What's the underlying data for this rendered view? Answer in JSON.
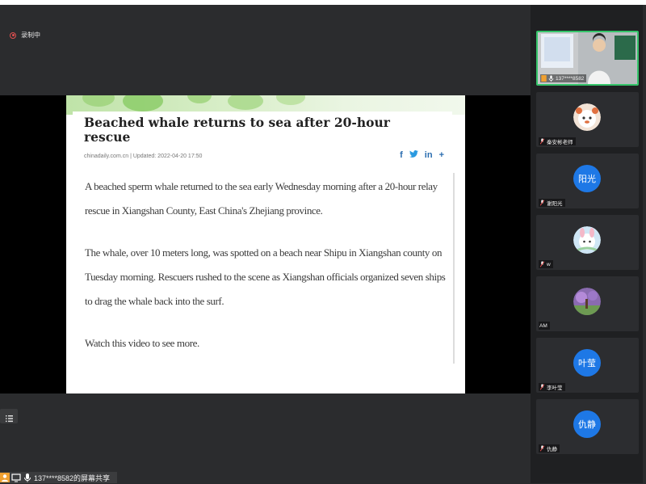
{
  "recording": {
    "label": "录制中"
  },
  "article": {
    "headline": "Beached whale returns to sea after 20-hour rescue",
    "source_line": "chinadaily.com.cn | Updated: 2022-04-20 17:50",
    "social": {
      "facebook": "f",
      "twitter": "t",
      "linkedin": "in",
      "more": "+"
    },
    "paragraphs": [
      "A beached sperm whale returned to the sea early Wednesday morning after a 20-hour relay rescue in Xiangshan County, East China's Zhejiang province.",
      "The whale, over 10 meters long, was spotted on a beach near Shipu in Xiangshan county on Tuesday morning. Rescuers rushed to the scene as Xiangshan officials organized seven ships to drag the whale back into the surf.",
      "Watch this video to see more."
    ]
  },
  "share_bar": {
    "label": "137****8582的屏幕共享"
  },
  "participants": [
    {
      "name": "137****8582",
      "type": "video"
    },
    {
      "name": "秦安彬老师",
      "type": "image"
    },
    {
      "name": "谢阳光",
      "type": "text",
      "avatar_text": "阳光"
    },
    {
      "name": "w",
      "type": "image"
    },
    {
      "name": "AM",
      "type": "image"
    },
    {
      "name": "李叶莹",
      "type": "text",
      "avatar_text": "叶莹"
    },
    {
      "name": "仇静",
      "type": "text",
      "avatar_text": "仇静"
    }
  ],
  "colors": {
    "accent": "#1e78e6",
    "active_border": "#35c46a",
    "link": "#2a6db0",
    "record": "#e05050"
  }
}
